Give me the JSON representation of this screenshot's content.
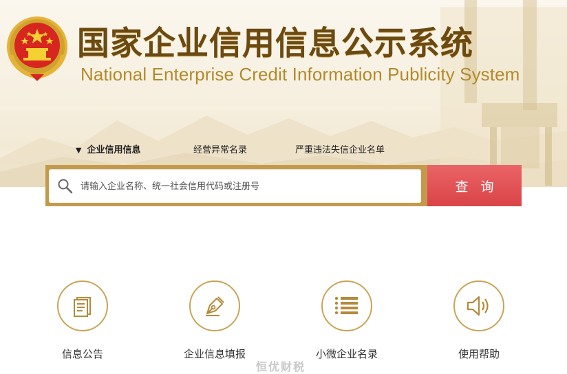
{
  "header": {
    "title_cn": "国家企业信用信息公示系统",
    "title_en": "National Enterprise Credit Information Publicity System"
  },
  "tabs": [
    {
      "label": "企业信用信息",
      "active": true
    },
    {
      "label": "经营异常名录",
      "active": false
    },
    {
      "label": "严重违法失信企业名单",
      "active": false
    }
  ],
  "search": {
    "placeholder": "请输入企业名称、统一社会信用代码或注册号",
    "value": "",
    "button_label": "查询"
  },
  "features": [
    {
      "label": "信息公告",
      "icon": "document-icon"
    },
    {
      "label": "企业信息填报",
      "icon": "pen-nib-icon"
    },
    {
      "label": "小微企业名录",
      "icon": "list-icon"
    },
    {
      "label": "使用帮助",
      "icon": "speaker-icon"
    }
  ],
  "watermark": "恒优财税",
  "colors": {
    "title": "#6b4a12",
    "gold": "#c49a4a",
    "button": "#e05558"
  }
}
